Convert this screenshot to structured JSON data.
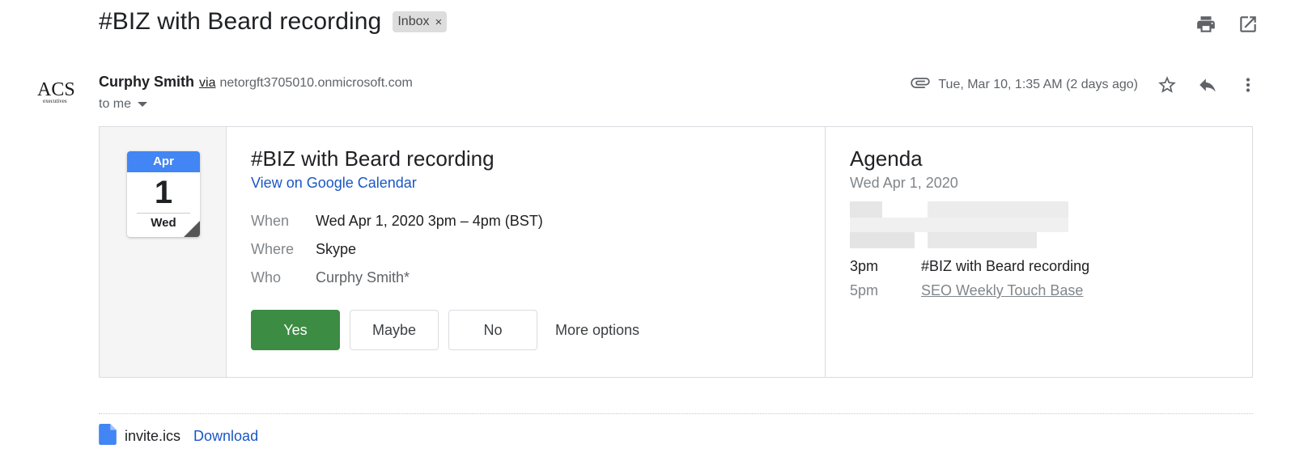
{
  "subject": {
    "title": "#BIZ with Beard recording",
    "label": "Inbox",
    "label_remove": "×"
  },
  "toolbar": {
    "print_icon": "print-icon",
    "open_new_window_icon": "open-in-new-icon"
  },
  "sender": {
    "logo_text": "ACS",
    "logo_subtext": "executives",
    "name": "Curphy Smith",
    "via": "via",
    "domain": "netorgft3705010.onmicrosoft.com",
    "recipient": "to me"
  },
  "message_meta": {
    "date": "Tue, Mar 10, 1:35 AM (2 days ago)",
    "attachment_icon": "paperclip-icon",
    "star_icon": "star-icon",
    "reply_icon": "reply-icon",
    "more_icon": "more-vert-icon"
  },
  "invite": {
    "calendar": {
      "month": "Apr",
      "day": "1",
      "weekday": "Wed"
    },
    "title": "#BIZ with Beard recording",
    "gcal_link": "View on Google Calendar",
    "details": [
      {
        "key": "When",
        "value": "Wed Apr 1, 2020 3pm – 4pm (BST)"
      },
      {
        "key": "Where",
        "value": "Skype"
      },
      {
        "key": "Who",
        "value": "Curphy Smith*"
      }
    ],
    "rsvp": {
      "yes": "Yes",
      "maybe": "Maybe",
      "no": "No",
      "more_options": "More options"
    }
  },
  "agenda": {
    "title": "Agenda",
    "date": "Wed Apr 1, 2020",
    "items": [
      {
        "time": "3pm",
        "event": "#BIZ with Beard recording"
      },
      {
        "time": "5pm",
        "event": "SEO Weekly Touch Base"
      }
    ]
  },
  "attachment": {
    "file_name": "invite.ics",
    "download": "Download"
  },
  "colors": {
    "yes_button": "#3c8c43",
    "link": "#1a56c6",
    "calendar_month": "#4285f4"
  }
}
